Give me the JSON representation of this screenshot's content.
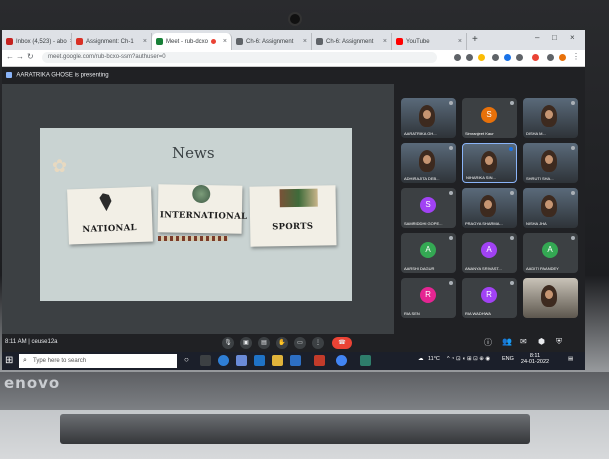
{
  "laptop": {
    "brand": "enovo"
  },
  "browser": {
    "tabs": [
      {
        "label": "Inbox (4,523) - abo",
        "icon_color": "#c5221f"
      },
      {
        "label": "Assignment: Ch-1",
        "icon_color": "#d93025"
      },
      {
        "label": "Meet - rub-dcxo",
        "icon_color": "#188038",
        "active": true
      },
      {
        "label": "Ch-6: Assignment",
        "icon_color": "#5f6368"
      },
      {
        "label": "Ch-6: Assignment",
        "icon_color": "#5f6368"
      },
      {
        "label": "YouTube",
        "icon_color": "#ff0000"
      }
    ],
    "new_tab": "+",
    "url": "meet.google.com/rub-bcxo-ssm?authuser=0"
  },
  "meet": {
    "presenting": "AARATRIKA GHOSE is presenting",
    "slide": {
      "title": "News",
      "cards": [
        "NATIONAL",
        "INTERNATIONAL",
        "SPORTS"
      ]
    },
    "participants": [
      {
        "name": "AARATRIKA GH...",
        "video": true
      },
      {
        "name": "Simranjeet Kaur",
        "initial": "S",
        "color": "#e8710a"
      },
      {
        "name": "DISHA M...",
        "video": true
      },
      {
        "name": "ADHIRAJITA DEB...",
        "video": true
      },
      {
        "name": "NIHARIKA SIN...",
        "video": true
      },
      {
        "name": "SHRUTI SHA...",
        "video": true
      },
      {
        "name": "SAMRIDDHI GOPE...",
        "initial": "S",
        "color": "#a142f4"
      },
      {
        "name": "PRAGYA SHARMA...",
        "video": true
      },
      {
        "name": "NISHA JHA",
        "video": true
      },
      {
        "name": "AARSHI DAGUR",
        "initial": "A",
        "color": "#34a853"
      },
      {
        "name": "ANANYA SRIVAST...",
        "initial": "A",
        "color": "#a142f4"
      },
      {
        "name": "AADITI PAANDEY",
        "initial": "A",
        "color": "#34a853"
      },
      {
        "name": "RIA SEN",
        "initial": "R",
        "color": "#e52592"
      },
      {
        "name": "RIA WADHWA",
        "initial": "R",
        "color": "#a142f4"
      },
      {
        "name": "",
        "video": true
      }
    ],
    "time": "8:11 AM",
    "meeting_code": "ceuse12a"
  },
  "taskbar": {
    "search_placeholder": "Type here to search",
    "weather": "11°C",
    "lang": "ENG",
    "clock_time": "8:11",
    "clock_date": "24-01-2022"
  }
}
